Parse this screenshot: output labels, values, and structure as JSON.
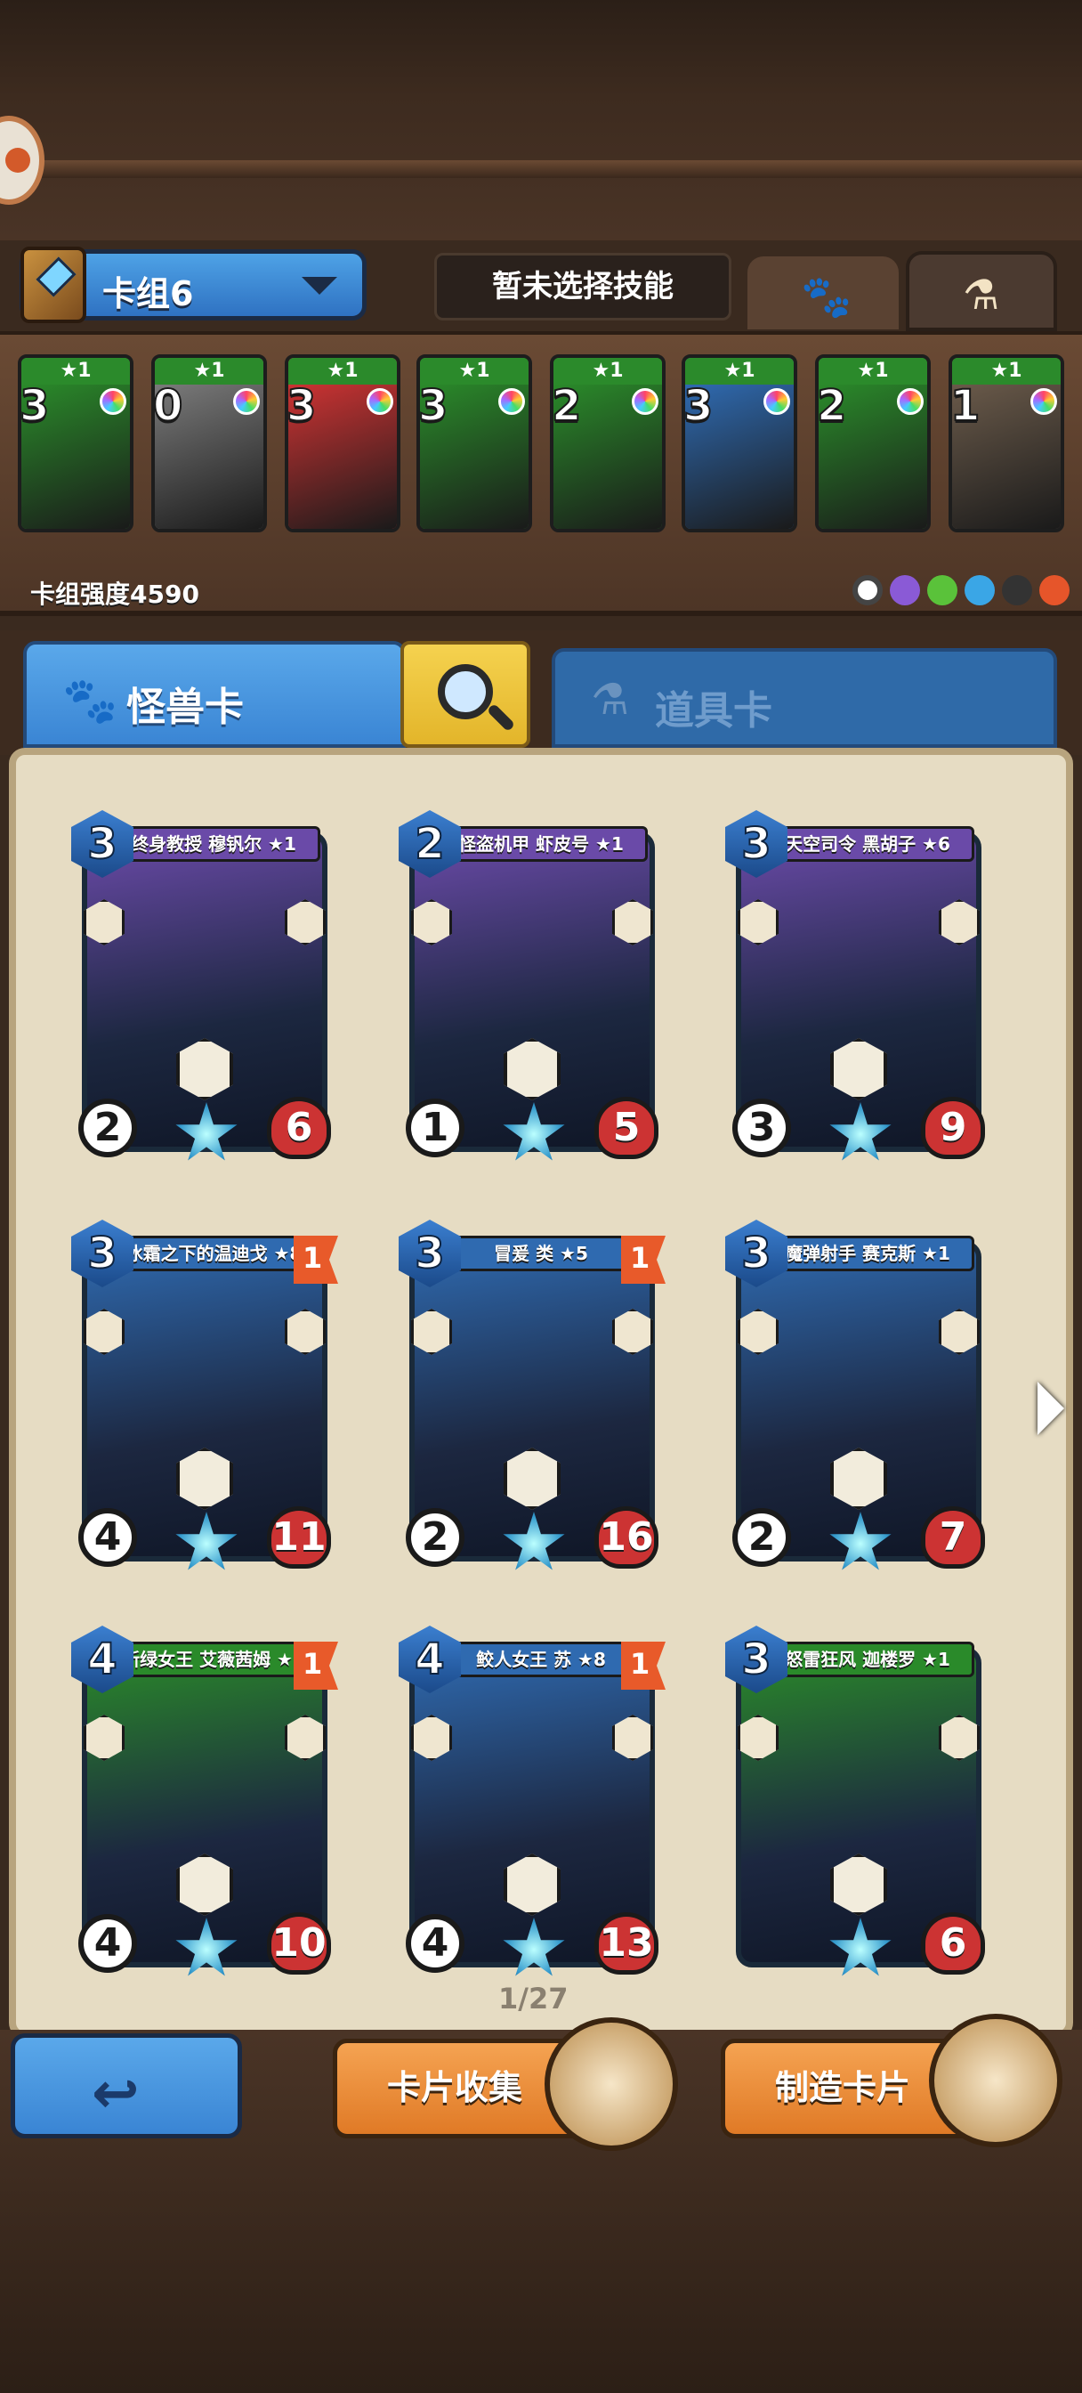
{
  "deck": {
    "name": "卡组6",
    "skill_placeholder": "暂未选择技能",
    "power_label": "卡组强度4590",
    "cards": [
      {
        "cost": "3",
        "stars": "★1",
        "color": "#2a8a2a"
      },
      {
        "cost": "0",
        "stars": "★1",
        "color": "#7a7a7a"
      },
      {
        "cost": "3",
        "stars": "★1",
        "color": "#c33"
      },
      {
        "cost": "3",
        "stars": "★1",
        "color": "#2a8a2a"
      },
      {
        "cost": "2",
        "stars": "★1",
        "color": "#2a8a2a"
      },
      {
        "cost": "3",
        "stars": "★1",
        "color": "#2f6ab0"
      },
      {
        "cost": "2",
        "stars": "★1",
        "color": "#2a8a2a"
      },
      {
        "cost": "1",
        "stars": "★1",
        "color": "#6a5a4a"
      }
    ]
  },
  "tabs": {
    "monster": "怪兽卡",
    "item": "道具卡"
  },
  "cards": [
    {
      "name": "终身教授 穆钒尔 ★1",
      "cost": "3",
      "atk": "2",
      "hp": "6",
      "color": "#6a4aa8",
      "flag": ""
    },
    {
      "name": "怪盗机甲 虾皮号 ★1",
      "cost": "2",
      "atk": "1",
      "hp": "5",
      "color": "#6a4aa8",
      "flag": ""
    },
    {
      "name": "天空司令 黑胡子 ★6",
      "cost": "3",
      "atk": "3",
      "hp": "9",
      "color": "#6a4aa8",
      "flag": ""
    },
    {
      "name": "冰霜之下的温迪戈 ★8",
      "cost": "3",
      "atk": "4",
      "hp": "11",
      "color": "#2f6ab0",
      "flag": "1"
    },
    {
      "name": "冒爰 类 ★5",
      "cost": "3",
      "atk": "2",
      "hp": "16",
      "color": "#2f6ab0",
      "flag": "1"
    },
    {
      "name": "魔弹射手 赛克斯 ★1",
      "cost": "3",
      "atk": "2",
      "hp": "7",
      "color": "#2f6ab0",
      "flag": ""
    },
    {
      "name": "新绿女王 艾薇茜姆 ★8",
      "cost": "4",
      "atk": "4",
      "hp": "10",
      "color": "#2a8a2a",
      "flag": "1"
    },
    {
      "name": "鲛人女王 苏 ★8",
      "cost": "4",
      "atk": "4",
      "hp": "13",
      "color": "#2f6ab0",
      "flag": "1"
    },
    {
      "name": "怒雷狂风 迦楼罗 ★1",
      "cost": "3",
      "atk": "",
      "hp": "6",
      "color": "#2a8a2a",
      "flag": ""
    }
  ],
  "pager": "1/27",
  "buttons": {
    "collect": "卡片收集",
    "craft": "制造卡片"
  },
  "icons": {
    "paw": "paw-icon",
    "potion": "potion-icon",
    "search": "search-icon",
    "back": "back-arrow-icon"
  }
}
